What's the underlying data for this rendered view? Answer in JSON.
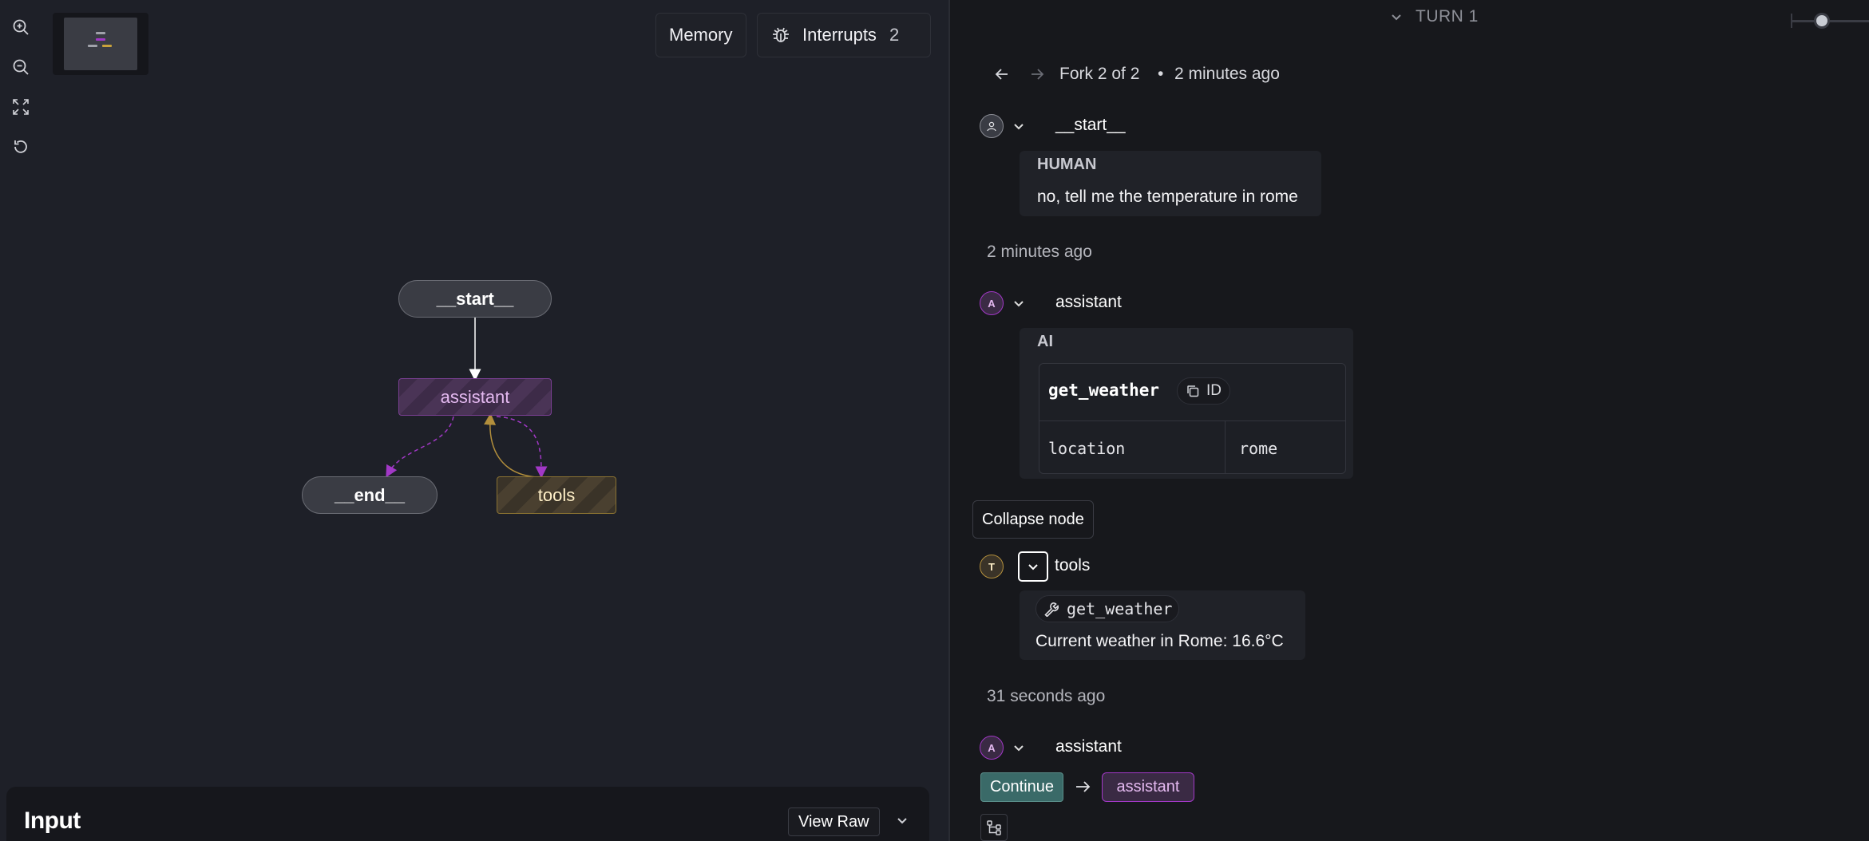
{
  "canvas": {
    "controls": {
      "zoom_in": "zoom-in-icon",
      "zoom_out": "zoom-out-icon",
      "fit_view": "fit-view-icon",
      "reset": "reset-icon"
    },
    "header": {
      "memory_label": "Memory",
      "interrupts_label": "Interrupts",
      "interrupts_count": "2"
    },
    "graph": {
      "nodes": {
        "start": "__start__",
        "assistant": "assistant",
        "end": "__end__",
        "tools": "tools"
      },
      "colors": {
        "assistant": "#7a3f93",
        "tools": "#8a7232",
        "edge_default": "#ffffff",
        "edge_conditional": "#a238c7",
        "edge_tools": "#b38f3c"
      }
    },
    "input_panel": {
      "title": "Input",
      "view_raw_label": "View Raw"
    }
  },
  "thread": {
    "turn_label": "TURN 1",
    "fork_label": "Fork 2 of 2",
    "fork_separator": "•",
    "fork_time": "2 minutes ago",
    "steps": {
      "start": {
        "node_name": "__start__",
        "role_label": "HUMAN",
        "message": "no, tell me the temperature in rome",
        "timestamp": "2 minutes ago"
      },
      "assistant_1": {
        "avatar_letter": "A",
        "node_name": "assistant",
        "role_label": "AI",
        "tool_call_name": "get_weather",
        "id_label": "ID",
        "args": [
          {
            "key": "location",
            "value": "rome"
          }
        ]
      },
      "tools": {
        "tooltip": "Collapse node",
        "avatar_letter": "T",
        "node_name": "tools",
        "tool_name": "get_weather",
        "result": "Current weather in Rome: 16.6°C",
        "timestamp": "31 seconds ago"
      },
      "assistant_2": {
        "avatar_letter": "A",
        "node_name": "assistant",
        "continue_label": "Continue",
        "continue_target": "assistant"
      }
    }
  }
}
